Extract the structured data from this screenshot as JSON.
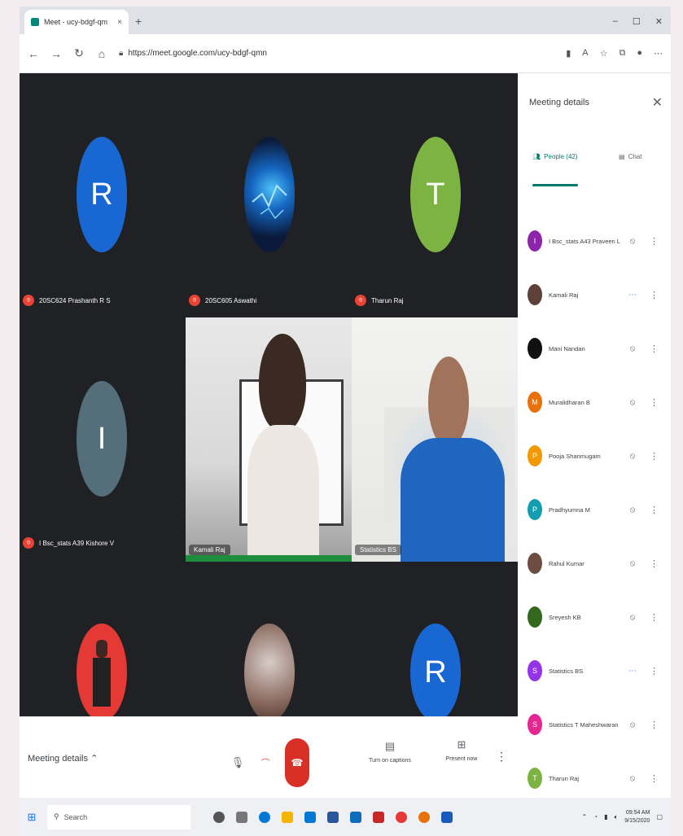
{
  "browser": {
    "tab_title": "Meet - ucy-bdgf-qm",
    "url": "https://meet.google.com/ucy-bdgf-qmn"
  },
  "tiles": [
    {
      "letter": "R",
      "color": "#1967d2",
      "name": "20SC624 Prashanth R S"
    },
    {
      "letter": "",
      "color": "#0b1a3a",
      "name": "20SC605 Aswathi"
    },
    {
      "letter": "T",
      "color": "#7cb342",
      "name": "Tharun Raj"
    },
    {
      "letter": "I",
      "color": "#546e7a",
      "name": "I Bsc_stats A39 Kishore V"
    }
  ],
  "video_tiles": [
    {
      "name": "Kamali Raj"
    },
    {
      "name": "Statistics BS"
    }
  ],
  "bottom_tiles": [
    {
      "letter": "",
      "color": "#e53935"
    },
    {
      "letter": "",
      "color": "#8d6e63"
    },
    {
      "letter": "R",
      "color": "#1967d2"
    }
  ],
  "panel": {
    "title": "Meeting details",
    "people_tab": "People (42)",
    "chat_tab": "Chat",
    "participants": [
      {
        "initial": "I",
        "color": "#8e24aa",
        "name": "I Bsc_stats A43 Praveen L",
        "mic": "muted"
      },
      {
        "initial": "",
        "color": "#5d4037",
        "name": "Kamali Raj",
        "mic": "speaking"
      },
      {
        "initial": "",
        "color": "#111111",
        "name": "Mani Nandan",
        "mic": "muted"
      },
      {
        "initial": "M",
        "color": "#e8710a",
        "name": "Muralidharan B",
        "mic": "muted"
      },
      {
        "initial": "P",
        "color": "#f29900",
        "name": "Pooja Shanmugam",
        "mic": "muted"
      },
      {
        "initial": "P",
        "color": "#129eaf",
        "name": "Pradhyumna M",
        "mic": "muted"
      },
      {
        "initial": "",
        "color": "#6d4c41",
        "name": "Rahul Kumar",
        "mic": "muted"
      },
      {
        "initial": "",
        "color": "#33691e",
        "name": "Sreyesh KB",
        "mic": "muted"
      },
      {
        "initial": "S",
        "color": "#9334e6",
        "name": "Statistics BS",
        "mic": "speaking"
      },
      {
        "initial": "S",
        "color": "#e52592",
        "name": "Statistics T Maheshwaran",
        "mic": "muted"
      },
      {
        "initial": "T",
        "color": "#7cb342",
        "name": "Tharun Raj",
        "mic": "muted"
      }
    ]
  },
  "bottombar": {
    "meeting_details": "Meeting details",
    "captions": "Turn on captions",
    "present": "Present now"
  },
  "taskbar": {
    "search": "Search",
    "time": "09:54 AM",
    "date": "9/15/2020"
  }
}
